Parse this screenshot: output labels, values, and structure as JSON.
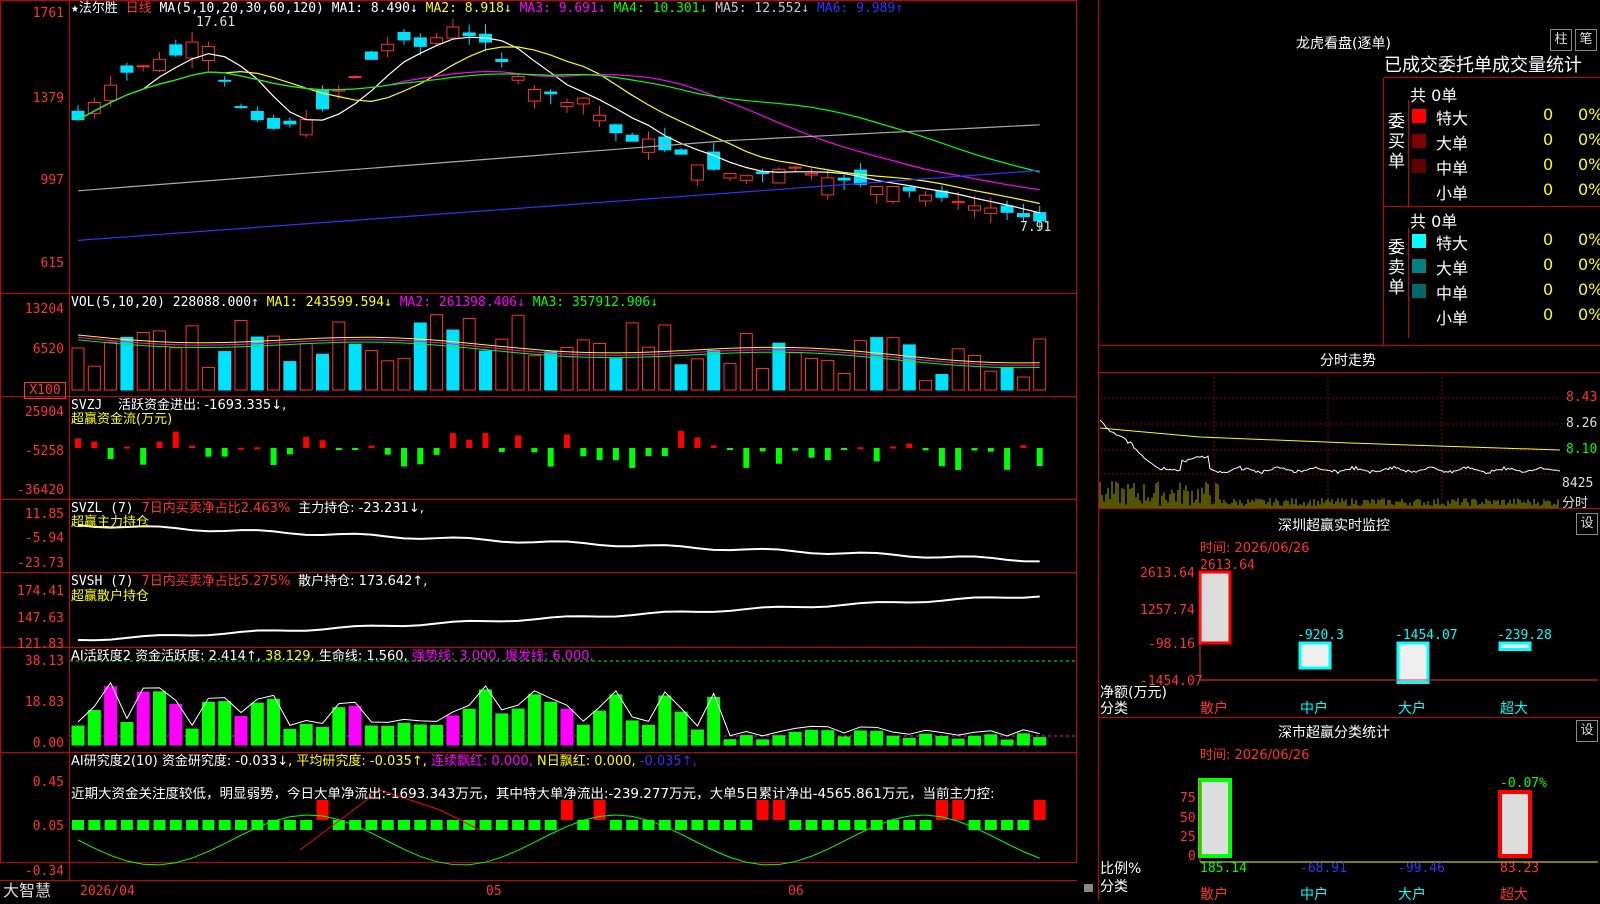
{
  "colors": {
    "up": "#ff3030",
    "down": "#00e0ff",
    "frame": "#c00000"
  },
  "header": {
    "star": "★",
    "name": "法尔胜",
    "period": "日线",
    "ma_label": "MA(5,10,20,30,60,120)",
    "ma1": "MA1: 8.490↓",
    "ma2": "MA2: 8.918↓",
    "ma3": "MA3: 9.691↓",
    "ma4": "MA4: 10.301↓",
    "ma5": "MA5: 12.552↓",
    "ma6": "MA6: 9.989↑",
    "max_label": "17.61",
    "min_label": "7.91"
  },
  "price_axis": [
    "1761",
    "1379",
    "997",
    "615"
  ],
  "vol": {
    "title": "VOL(5,10,20)",
    "value": "228088.000↑",
    "ma1": "MA1: 243599.594↓",
    "ma2": "MA2: 261398.406↓",
    "ma3": "MA3: 357912.906↓",
    "axis": [
      "13204",
      "6520",
      "X100"
    ]
  },
  "svzj": {
    "title": "SVZJ",
    "label": "活跃资金进出: -1693.335↓,",
    "sub": "超赢资金流(万元)",
    "axis": [
      "25904",
      "-5258",
      "-36420"
    ]
  },
  "svzl": {
    "title": "SVZL (7)",
    "label1": "7日内买卖净占比2.463%",
    "label2": "主力持仓: -23.231↓,",
    "sub": "超赢主力持仓",
    "axis": [
      "11.85",
      "-5.94",
      "-23.73"
    ]
  },
  "svsh": {
    "title": "SVSH (7)",
    "label1": "7日内买卖净占比5.275%",
    "label2": "散户持仓: 173.642↑,",
    "sub": "超赢散户持仓",
    "axis": [
      "174.41",
      "147.63",
      "121.83"
    ]
  },
  "ai1": {
    "title": "AI活跃度2",
    "label": "资金活跃度: 2.414↑,",
    "v2": "38.129,",
    "v3": "生命线: 1.560,",
    "v4": "强势线: 3.000,",
    "v5": "爆发线: 6.000,",
    "axis": [
      "38.13",
      "18.83",
      "0.00"
    ]
  },
  "ai2": {
    "title": "AI研究度2(10)",
    "label": "资金研究度: -0.033↓,",
    "v2": "平均研究度: -0.035↑,",
    "v3": "连续飘红: 0.000,",
    "v4": "N日飘红: 0.000,",
    "v5": "-0.035↑,",
    "comment": "近期大资金关注度较低，明显弱势，今日大单净流出:-1693.343万元，其中特大单净流出:-239.277万元，大单5日累计净出-4565.861万元，当前主力控:",
    "axis": [
      "0.45",
      "0.05",
      "-0.34"
    ]
  },
  "bottom": {
    "brand": "大智慧",
    "date": "2026/04",
    "m05": "05",
    "m06": "06"
  },
  "lhkp": {
    "title": "龙虎看盘(逐单)",
    "btn1": "柱",
    "btn2": "笔",
    "header": "已成交委托单成交量统计",
    "buy_label": "委买单",
    "sell_label": "委卖单",
    "buy_total": "共 0单",
    "sell_total": "共 0单",
    "buy": [
      {
        "name": "特大",
        "v": "0",
        "p": "0%",
        "c": "#ff0000"
      },
      {
        "name": "大单",
        "v": "0",
        "p": "0%",
        "c": "#800000"
      },
      {
        "name": "中单",
        "v": "0",
        "p": "0%",
        "c": "#600000"
      },
      {
        "name": "小单",
        "v": "0",
        "p": "0%",
        "c": ""
      }
    ],
    "sell": [
      {
        "name": "特大",
        "v": "0",
        "p": "0%",
        "c": "#00ffff"
      },
      {
        "name": "大单",
        "v": "0",
        "p": "0%",
        "c": "#008080"
      },
      {
        "name": "中单",
        "v": "0",
        "p": "0%",
        "c": "#006868"
      },
      {
        "name": "小单",
        "v": "0",
        "p": "0%",
        "c": ""
      }
    ]
  },
  "fs": {
    "title": "分时走势",
    "p1": "8.43",
    "p2": "8.26",
    "p3": "8.10",
    "vol": "8425",
    "lbl": "分时"
  },
  "sz": {
    "title": "深圳超赢实时监控",
    "btn": "设",
    "time": "时间: 2026/06/26",
    "axis": [
      "2613.64",
      "1257.74",
      "-98.16",
      "-1454.07"
    ],
    "ylabel": "净额(万元)",
    "xlabel": "分类",
    "chart_data": {
      "type": "bar",
      "categories": [
        "散户",
        "中户",
        "大户",
        "超大"
      ],
      "values": [
        2613.64,
        -920.3,
        -1454.07,
        -239.28
      ],
      "labels": [
        "2613.64",
        "-920.3",
        "-1454.07",
        "-239.28"
      ],
      "ylim": [
        -1454.07,
        2613.64
      ]
    }
  },
  "ss": {
    "title": "深市超赢分类统计",
    "btn": "设",
    "time": "时间: 2026/06/26",
    "axis": [
      "75",
      "50",
      "25",
      "0"
    ],
    "ylabel": "比例%",
    "xlabel": "分类",
    "top_label": "-0.07%",
    "chart_data": {
      "type": "bar",
      "categories": [
        "散户",
        "中户",
        "大户",
        "超大"
      ],
      "values": [
        185.14,
        -68.91,
        -99.46,
        83.23
      ],
      "labels": [
        "185.14",
        "-68.91",
        "-99.46",
        "83.23"
      ]
    }
  }
}
